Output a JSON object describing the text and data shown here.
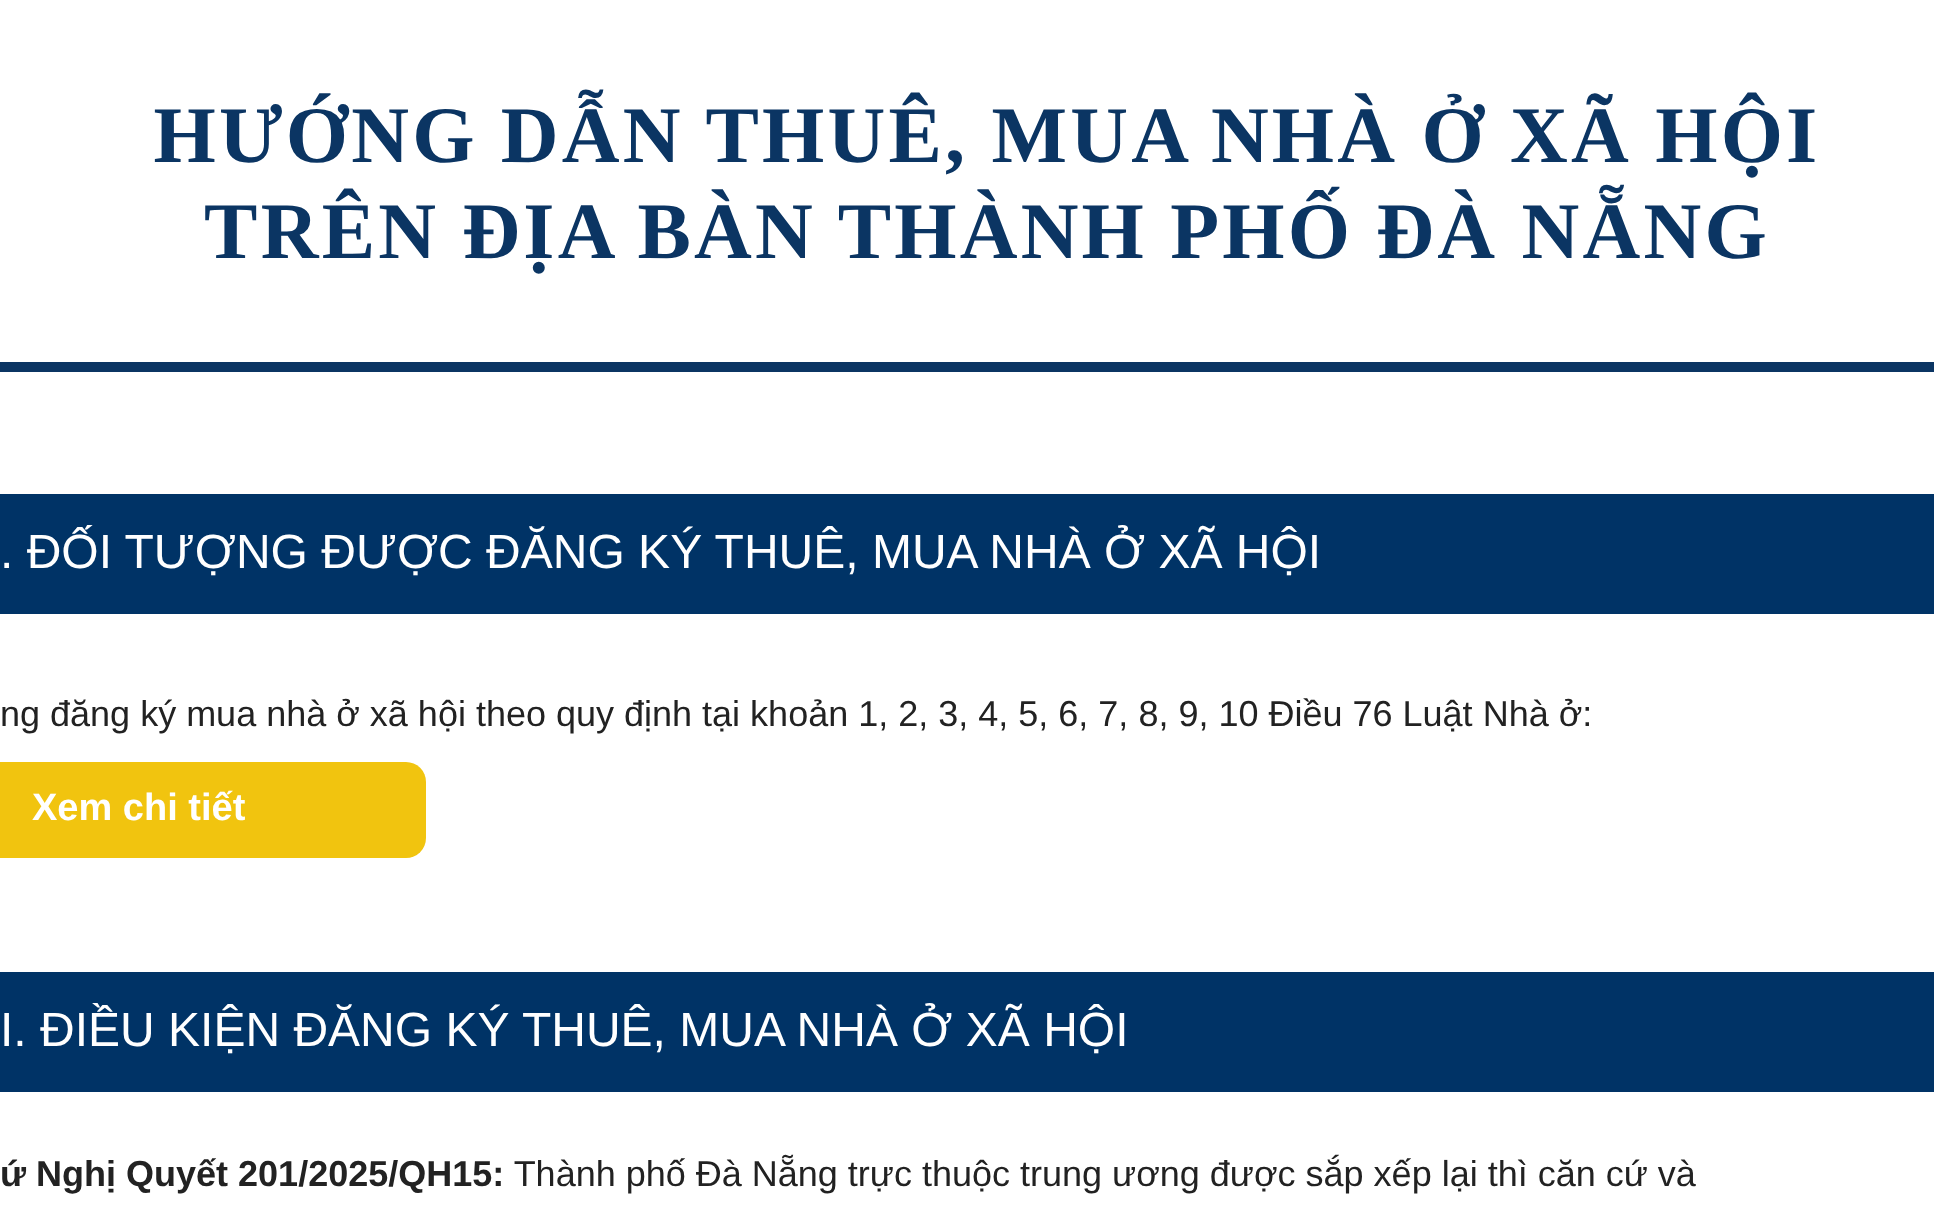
{
  "title_lines": [
    "HƯỚNG DẪN THUÊ, MUA NHÀ Ở XÃ HỘI",
    "TRÊN ĐỊA BÀN THÀNH PHỐ ĐÀ NẴNG"
  ],
  "sections": [
    {
      "heading": ". ĐỐI TƯỢNG ĐƯỢC ĐĂNG KÝ THUÊ, MUA NHÀ Ở XÃ HỘI",
      "paragraph": "ng đăng ký mua nhà ở xã hội theo quy định tại khoản 1, 2, 3, 4, 5, 6, 7, 8, 9, 10 Điều 76 Luật Nhà ở:",
      "button": "Xem chi tiết"
    },
    {
      "heading": "I. ĐIỀU KIỆN ĐĂNG KÝ THUÊ, MUA NHÀ Ở XÃ HỘI",
      "paragraph": "**ứ Nghị Quyết 201/2025/QH15:** Thành phố Đà Nẵng trực thuộc trung ương được sắp xếp lại thì căn cứ và"
    }
  ]
}
